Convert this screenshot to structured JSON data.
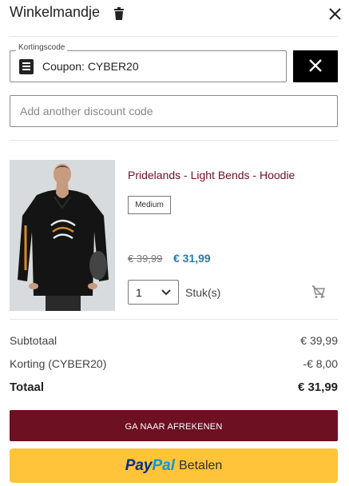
{
  "header": {
    "title": "Winkelmandje"
  },
  "coupon": {
    "legend": "Kortingscode",
    "applied_text": "Coupon: CYBER20"
  },
  "discount_input": {
    "placeholder": "Add another discount code",
    "value": ""
  },
  "product": {
    "name": "Pridelands - Light Bends - Hoodie",
    "size": "Medium",
    "old_price": "€ 39,99",
    "new_price": "€ 31,99",
    "quantity": "1",
    "quantity_unit": "Stuk(s)",
    "image_icon": "hoodie-product-photo"
  },
  "summary": {
    "subtotal_label": "Subtotaal",
    "subtotal_value": "€ 39,99",
    "discount_label": "Korting (CYBER20)",
    "discount_value": "-€ 8,00",
    "total_label": "Totaal",
    "total_value": "€ 31,99"
  },
  "buttons": {
    "checkout_label": "GA NAAR AFREKENEN",
    "paypal_part1": "Pay",
    "paypal_part2": "Pal",
    "paypal_suffix": "Betalen"
  },
  "icons": {
    "trash": "trash-icon",
    "close": "close-icon",
    "coupon": "coupon-document-icon",
    "remove_coupon": "close-icon",
    "chevron": "chevron-down-icon",
    "cart_remove": "cart-remove-icon"
  },
  "colors": {
    "brand": "#6d1022",
    "price_accent": "#2a7aa6",
    "paypal_yellow": "#ffc439",
    "paypal_dark_blue": "#003087",
    "paypal_light_blue": "#009cde"
  }
}
